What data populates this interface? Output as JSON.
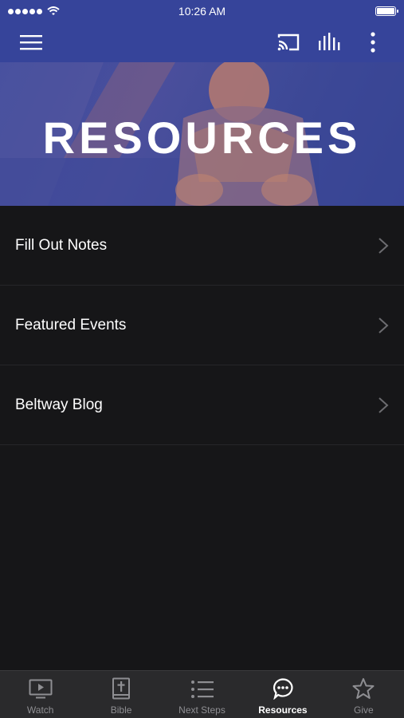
{
  "status_bar": {
    "time": "10:26 AM",
    "icons": [
      "signal-dots-icon",
      "wifi-icon",
      "battery-icon"
    ]
  },
  "nav_bar": {
    "icons": [
      "hamburger-menu-icon",
      "cast-icon",
      "audio-bars-icon",
      "more-vertical-icon"
    ]
  },
  "hero": {
    "title": "RESOURCES"
  },
  "list": {
    "items": [
      {
        "label": "Fill Out Notes"
      },
      {
        "label": "Featured Events"
      },
      {
        "label": "Beltway Blog"
      }
    ]
  },
  "tab_bar": {
    "active": "Resources",
    "tabs": [
      {
        "label": "Watch",
        "icon": "play-screen-icon"
      },
      {
        "label": "Bible",
        "icon": "bible-icon"
      },
      {
        "label": "Next Steps",
        "icon": "list-icon"
      },
      {
        "label": "Resources",
        "icon": "chat-bubble-icon"
      },
      {
        "label": "Give",
        "icon": "star-icon"
      }
    ]
  },
  "colors": {
    "header_blue": "#36449a",
    "background": "#161618",
    "tab_inactive": "#8e8e92",
    "tab_active": "#ffffff"
  }
}
